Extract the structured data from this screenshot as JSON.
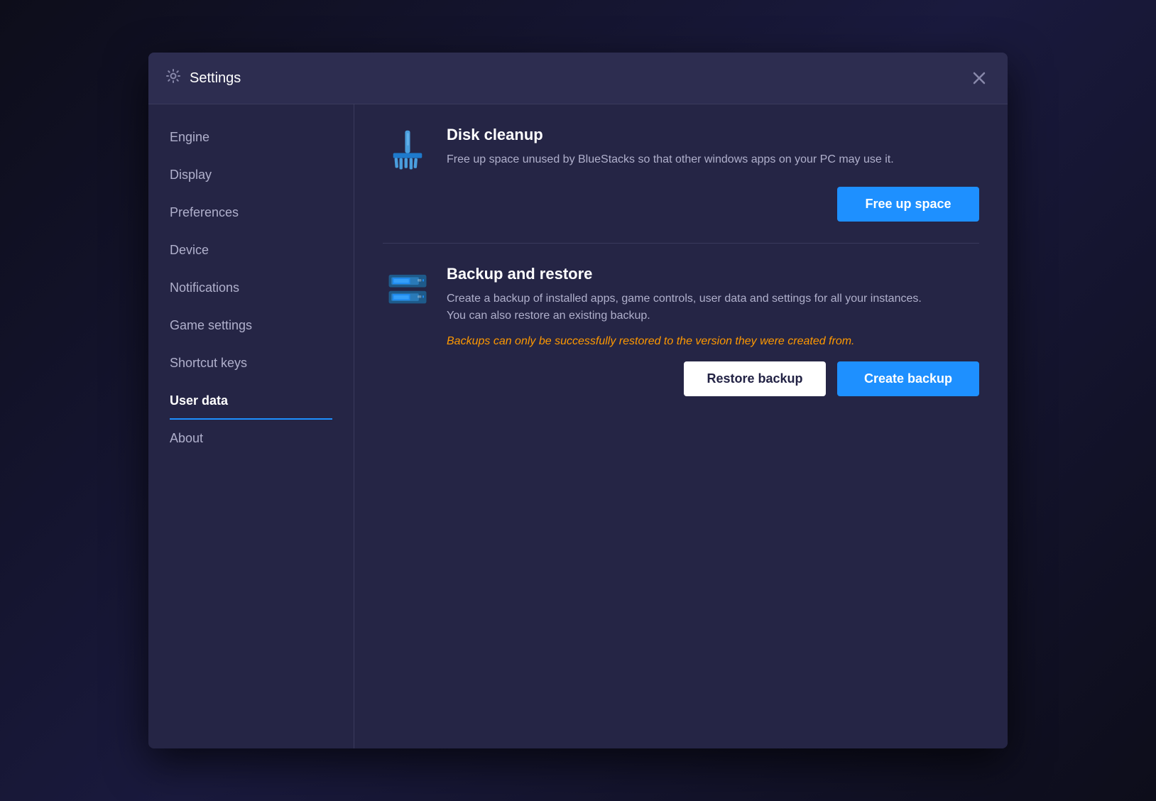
{
  "app": {
    "title": "Settings",
    "title_icon": "gear-icon"
  },
  "sidebar": {
    "items": [
      {
        "id": "engine",
        "label": "Engine",
        "active": false
      },
      {
        "id": "display",
        "label": "Display",
        "active": false
      },
      {
        "id": "preferences",
        "label": "Preferences",
        "active": false
      },
      {
        "id": "device",
        "label": "Device",
        "active": false
      },
      {
        "id": "notifications",
        "label": "Notifications",
        "active": false
      },
      {
        "id": "game-settings",
        "label": "Game settings",
        "active": false
      },
      {
        "id": "shortcut-keys",
        "label": "Shortcut keys",
        "active": false
      },
      {
        "id": "user-data",
        "label": "User data",
        "active": true
      },
      {
        "id": "about",
        "label": "About",
        "active": false
      }
    ]
  },
  "main": {
    "disk_cleanup": {
      "title": "Disk cleanup",
      "description": "Free up space unused by BlueStacks so that other windows apps on your PC may use it.",
      "action_label": "Free up space"
    },
    "backup_restore": {
      "title": "Backup and restore",
      "description": "Create a backup of installed apps, game controls, user data and settings for all your instances. You can also restore an existing backup.",
      "warning": "Backups can only be successfully restored to the version they were created from.",
      "restore_label": "Restore backup",
      "create_label": "Create backup"
    }
  }
}
